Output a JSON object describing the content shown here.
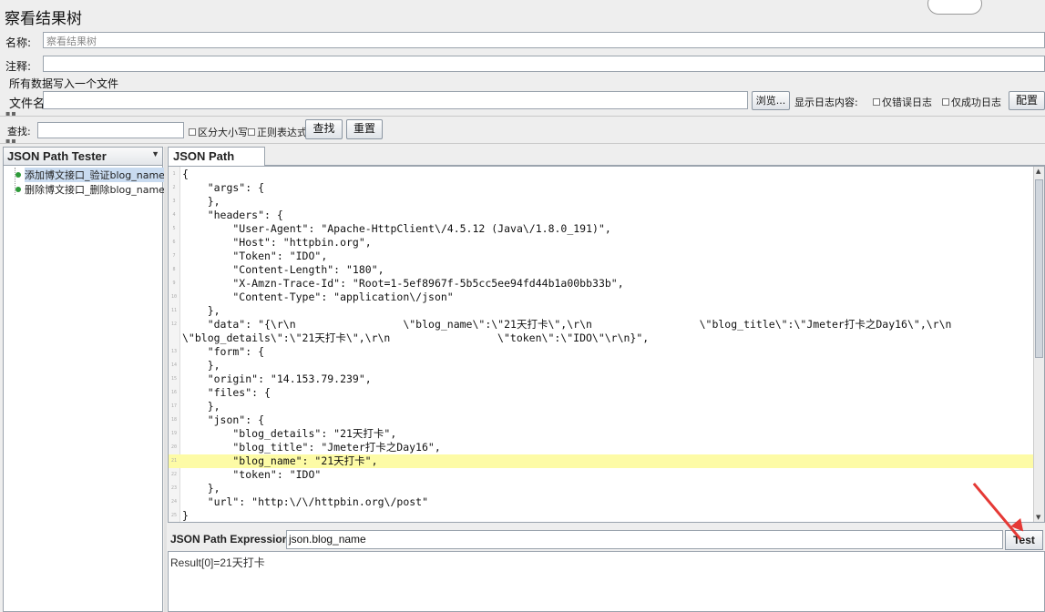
{
  "window": {
    "title": "察看结果树"
  },
  "form": {
    "name_label": "名称:",
    "name_value": "察看结果树",
    "comment_label": "注释:",
    "comment_value": "",
    "write_all_label": "所有数据写入一个文件",
    "filename_label": "文件名",
    "filename_value": "",
    "browse_button": "浏览...",
    "log_display_label": "显示日志内容:",
    "errors_only_label": "仅错误日志",
    "success_only_label": "仅成功日志",
    "configure_button": "配置"
  },
  "search": {
    "label": "查找:",
    "value": "",
    "case_sensitive_label": "区分大小写",
    "regex_label": "正则表达式",
    "find_button": "查找",
    "reset_button": "重置"
  },
  "tree": {
    "renderer_select": "JSON Path Tester",
    "items": [
      {
        "label": "添加博文接口_验证blog_name",
        "status": "success",
        "selected": true
      },
      {
        "label": "删除博文接口_删除blog_name",
        "status": "success",
        "selected": false
      }
    ]
  },
  "tester": {
    "tab_label": "JSON Path Tester",
    "response_lines": [
      {
        "num": "1",
        "text": "{"
      },
      {
        "num": "2",
        "text": "    \"args\": {"
      },
      {
        "num": "3",
        "text": "    },"
      },
      {
        "num": "4",
        "text": "    \"headers\": {"
      },
      {
        "num": "5",
        "text": "        \"User-Agent\": \"Apache-HttpClient\\/4.5.12 (Java\\/1.8.0_191)\","
      },
      {
        "num": "6",
        "text": "        \"Host\": \"httpbin.org\","
      },
      {
        "num": "7",
        "text": "        \"Token\": \"IDO\","
      },
      {
        "num": "8",
        "text": "        \"Content-Length\": \"180\","
      },
      {
        "num": "9",
        "text": "        \"X-Amzn-Trace-Id\": \"Root=1-5ef8967f-5b5cc5ee94fd44b1a00bb33b\","
      },
      {
        "num": "10",
        "text": "        \"Content-Type\": \"application\\/json\""
      },
      {
        "num": "11",
        "text": "    },"
      },
      {
        "num": "12",
        "text": "    \"data\": \"{\\r\\n                 \\\"blog_name\\\":\\\"21天打卡\\\",\\r\\n                 \\\"blog_title\\\":\\\"Jmeter打卡之Day16\\\",\\r\\n"
      },
      {
        "num": "",
        "text": "\\\"blog_details\\\":\\\"21天打卡\\\",\\r\\n                 \\\"token\\\":\\\"IDO\\\"\\r\\n}\","
      },
      {
        "num": "13",
        "text": "    \"form\": {"
      },
      {
        "num": "14",
        "text": "    },"
      },
      {
        "num": "15",
        "text": "    \"origin\": \"14.153.79.239\","
      },
      {
        "num": "16",
        "text": "    \"files\": {"
      },
      {
        "num": "17",
        "text": "    },"
      },
      {
        "num": "18",
        "text": "    \"json\": {"
      },
      {
        "num": "19",
        "text": "        \"blog_details\": \"21天打卡\","
      },
      {
        "num": "20",
        "text": "        \"blog_title\": \"Jmeter打卡之Day16\","
      },
      {
        "num": "21",
        "text": "        \"blog_name\": \"21天打卡\","
      },
      {
        "num": "22",
        "text": "        \"token\": \"IDO\""
      },
      {
        "num": "23",
        "text": "    },"
      },
      {
        "num": "24",
        "text": "    \"url\": \"http:\\/\\/httpbin.org\\/post\""
      },
      {
        "num": "25",
        "text": "}"
      }
    ],
    "highlighted_line_index": 21,
    "expression_label": "JSON Path Expression",
    "expression_value": "json.blog_name",
    "test_button": "Test",
    "result_text": "Result[0]=21天打卡"
  },
  "colors": {
    "highlight": "#fdfba6",
    "annotation_arrow": "#e53935",
    "success_dot": "#2e9a39"
  }
}
